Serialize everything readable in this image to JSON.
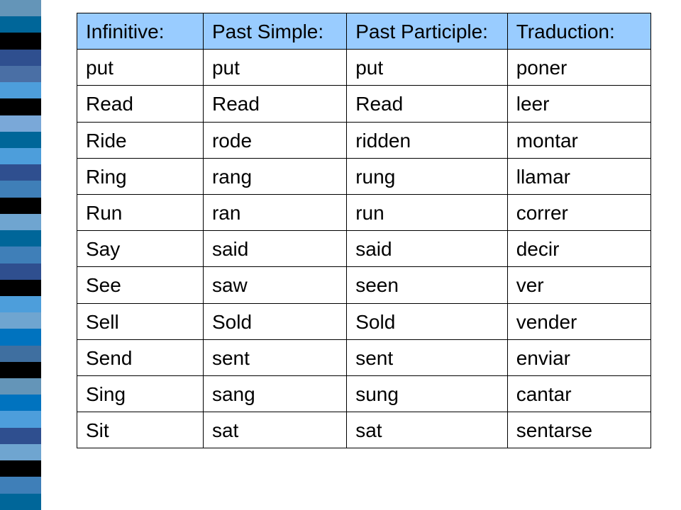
{
  "table": {
    "headers": {
      "infinitive": "Infinitive:",
      "past_simple": "Past Simple:",
      "past_participle": "Past Participle:",
      "traduction": "Traduction:"
    },
    "rows": [
      {
        "infinitive": "put",
        "past_simple": "put",
        "past_participle": "put",
        "traduction": "poner"
      },
      {
        "infinitive": "Read",
        "past_simple": "Read",
        "past_participle": "Read",
        "traduction": "leer"
      },
      {
        "infinitive": "Ride",
        "past_simple": "rode",
        "past_participle": "ridden",
        "traduction": "montar"
      },
      {
        "infinitive": "Ring",
        "past_simple": "rang",
        "past_participle": "rung",
        "traduction": "llamar"
      },
      {
        "infinitive": "Run",
        "past_simple": "ran",
        "past_participle": "run",
        "traduction": "correr"
      },
      {
        "infinitive": "Say",
        "past_simple": "said",
        "past_participle": "said",
        "traduction": "decir"
      },
      {
        "infinitive": "See",
        "past_simple": "saw",
        "past_participle": "seen",
        "traduction": "ver"
      },
      {
        "infinitive": "Sell",
        "past_simple": "Sold",
        "past_participle": "Sold",
        "traduction": "vender"
      },
      {
        "infinitive": "Send",
        "past_simple": "sent",
        "past_participle": "sent",
        "traduction": "enviar"
      },
      {
        "infinitive": "Sing",
        "past_simple": "sang",
        "past_participle": "sung",
        "traduction": "cantar"
      },
      {
        "infinitive": "Sit",
        "past_simple": "sat",
        "past_participle": "sat",
        "traduction": "sentarse"
      }
    ]
  },
  "stripe_colors": [
    "#6495b8",
    "#006699",
    "#000000",
    "#2f4f8f",
    "#4a6fa5",
    "#4d9edb",
    "#000000",
    "#7aa8d8",
    "#006699",
    "#4d9edb",
    "#2f4f8f",
    "#3f7fb8",
    "#000000",
    "#6fa5d0",
    "#006699",
    "#3f7fb8",
    "#2f4f8f",
    "#000000",
    "#4d9edb",
    "#6fa5d0",
    "#0073bf",
    "#3f6fa0",
    "#000000",
    "#6495b8",
    "#0073bf",
    "#4d9edb",
    "#2f4f8f",
    "#6fa5d0",
    "#000000",
    "#3f7fb8",
    "#006699"
  ]
}
